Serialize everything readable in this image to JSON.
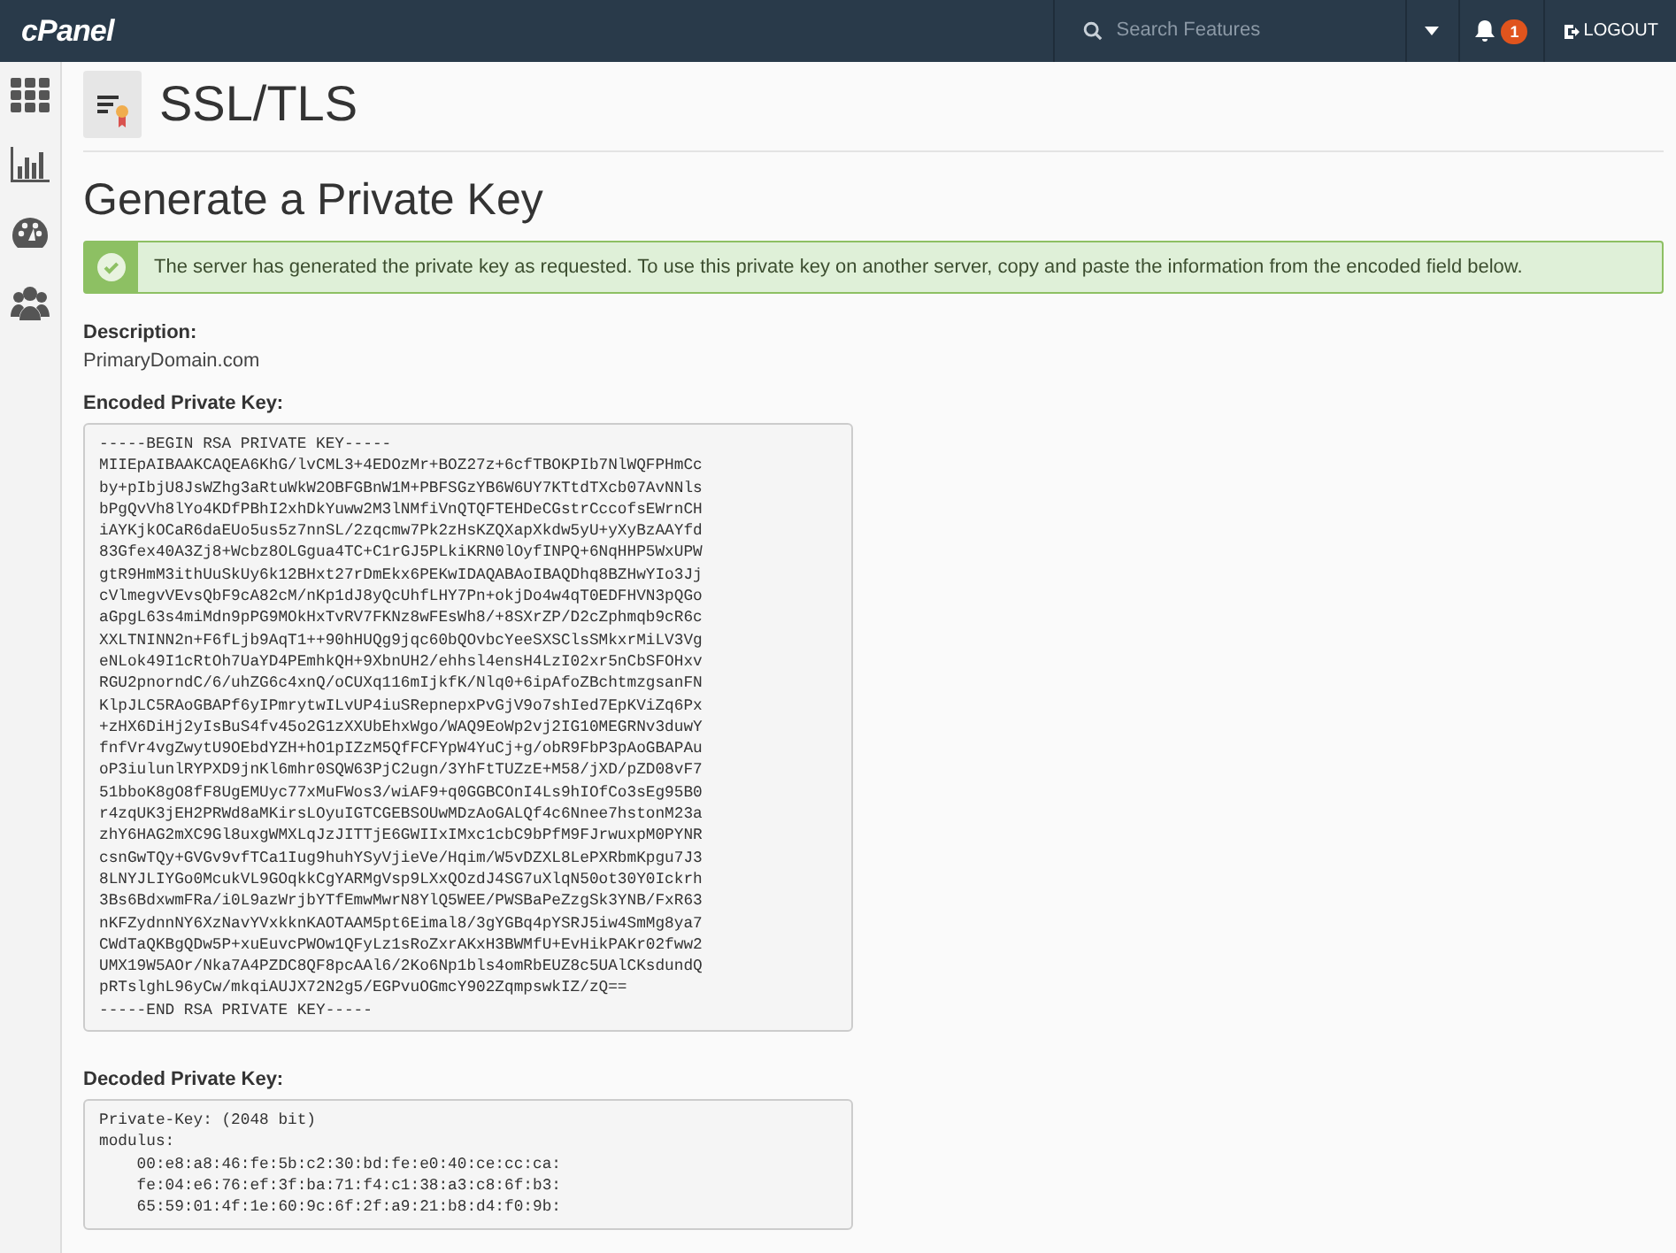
{
  "topbar": {
    "logo": "cPanel",
    "search": {
      "placeholder": "Search Features"
    },
    "notifications": "1",
    "logout": "LOGOUT"
  },
  "sidebar": {
    "items": [
      {
        "kind": "apps",
        "selected": false
      },
      {
        "kind": "stats",
        "selected": false
      },
      {
        "kind": "dashboard",
        "selected": false
      },
      {
        "kind": "users",
        "selected": false
      }
    ]
  },
  "page_title": "SSL/TLS",
  "heading": "Generate a Private Key",
  "alert": {
    "kind": "success",
    "text": "The server has generated the private key as requested. To use this private key on another server, copy and paste the information from the encoded field below."
  },
  "description": {
    "label": "Description:",
    "value": "PrimaryDomain.com"
  },
  "encoded": {
    "label": "Encoded Private Key:",
    "lines": [
      "-----BEGIN RSA PRIVATE KEY-----",
      "MIIEpAIBAAKCAQEA6KhG/lvCML3+4EDOzMr+BOZ27z+6cfTBOKPIb7NlWQFPHmCc",
      "by+pIbjU8JsWZhg3aRtuWkW2OBFGBnW1M+PBFSGzYB6W6UY7KTtdTXcb07AvNNls",
      "bPgQvVh8lYo4KDfPBhI2xhDkYuww2M3lNMfiVnQTQFTEHDeCGstrCccofsEWrnCH",
      "iAYKjkOCaR6daEUo5us5z7nnSL/2zqcmw7Pk2zHsKZQXapXkdw5yU+yXyBzAAYfd",
      "83Gfex40A3Zj8+Wcbz8OLGgua4TC+C1rGJ5PLkiKRN0lOyfINPQ+6NqHHP5WxUPW",
      "gtR9HmM3ithUuSkUy6k12BHxt27rDmEkx6PEKwIDAQABAoIBAQDhq8BZHwYIo3Jj",
      "cVlmegvVEvsQbF9cA82cM/nKp1dJ8yQcUhfLHY7Pn+okjDo4w4qT0EDFHVN3pQGo",
      "aGpgL63s4miMdn9pPG9MOkHxTvRV7FKNz8wFEsWh8/+8SXrZP/D2cZphmqb9cR6c",
      "XXLTNINN2n+F6fLjb9AqT1++90hHUQg9jqc60bQOvbcYeeSXSClsSMkxrMiLV3Vg",
      "eNLok49I1cRtOh7UaYD4PEmhkQH+9XbnUH2/ehhsl4ensH4LzI02xr5nCbSFOHxv",
      "RGU2pnorndC/6/uhZG6c4xnQ/oCUXq116mIjkfK/Nlq0+6ipAfoZBchtmzgsanFN",
      "KlpJLC5RAoGBAPf6yIPmrytwILvUP4iuSRepnepxPvGjV9o7shIed7EpKViZq6Px",
      "+zHX6DiHj2yIsBuS4fv45o2G1zXXUbEhxWgo/WAQ9EoWp2vj2IG10MEGRNv3duwY",
      "fnfVr4vgZwytU9OEbdYZH+hO1pIZzM5QfFCFYpW4YuCj+g/obR9FbP3pAoGBAPAu",
      "oP3iulunlRYPXD9jnKl6mhr0SQW63PjC2ugn/3YhFtTUZzE+M58/jXD/pZD08vF7",
      "51bboK8gO8fF8UgEMUyc77xMuFWos3/wiAF9+q0GGBCOnI4Ls9hIOfCo3sEg95B0",
      "r4zqUK3jEH2PRWd8aMKirsLOyuIGTCGEBSOUwMDzAoGALQf4c6Nnee7hstonM23a",
      "zhY6HAG2mXC9Gl8uxgWMXLqJzJITTjE6GWIIxIMxc1cbC9bPfM9FJrwuxpM0PYNR",
      "csnGwTQy+GVGv9vfTCa1Iug9huhYSyVjieVe/Hqim/W5vDZXL8LePXRbmKpgu7J3",
      "8LNYJLIYGo0McukVL9GOqkkCgYARMgVsp9LXxQOzdJ4SG7uXlqN50ot30Y0Ickrh",
      "3Bs6BdxwmFRa/i0L9azWrjbYTfEmwMwrN8YlQ5WEE/PWSBaPeZzgSk3YNB/FxR63",
      "nKFZydnnNY6XzNavYVxkknKAOTAAM5pt6Eimal8/3gYGBq4pYSRJ5iw4SmMg8ya7",
      "CWdTaQKBgQDw5P+xuEuvcPWOw1QFyLz1sRoZxrAKxH3BWMfU+EvHikPAKr02fww2",
      "UMX19W5AOr/Nka7A4PZDC8QF8pcAAl6/2Ko6Np1bls4omRbEUZ8c5UAlCKsdundQ",
      "pRTslghL96yCw/mkqiAUJX72N2g5/EGPvuOGmcY902ZqmpswkIZ/zQ==",
      "-----END RSA PRIVATE KEY-----"
    ]
  },
  "decoded": {
    "label": "Decoded Private Key:",
    "lines": [
      "Private-Key: (2048 bit)",
      "modulus:",
      "    00:e8:a8:46:fe:5b:c2:30:bd:fe:e0:40:ce:cc:ca:",
      "    fe:04:e6:76:ef:3f:ba:71:f4:c1:38:a3:c8:6f:b3:",
      "    65:59:01:4f:1e:60:9c:6f:2f:a9:21:b8:d4:f0:9b:"
    ]
  }
}
